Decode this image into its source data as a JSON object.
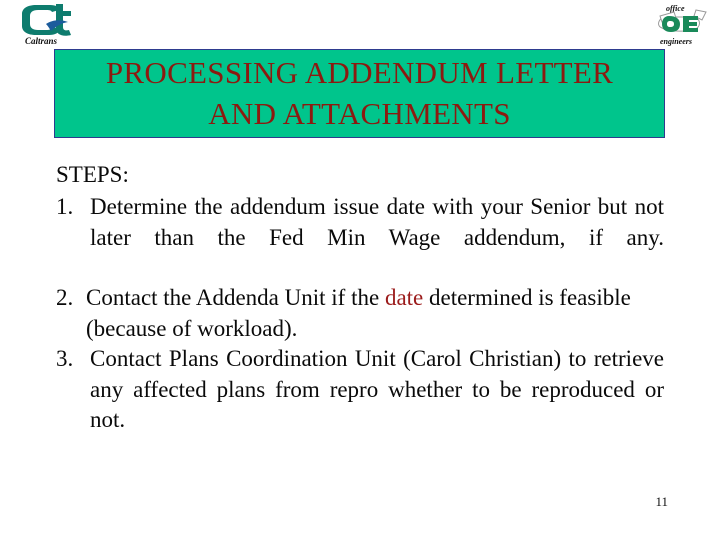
{
  "slide": {
    "title_line1": "PROCESSING ADDENDUM LETTER",
    "title_line2": "AND ATTACHMENTS",
    "title_full": "PROCESSING ADDENDUM LETTER\nAND ATTACHMENTS",
    "banner_color": "#00C58C",
    "banner_border_color": "#2E3B8F",
    "title_color": "#8C1A10",
    "page_number": "11"
  },
  "logos": {
    "left": {
      "name": "caltrans-logo",
      "wordmark": "Caltrans",
      "monogram": "Ct",
      "color": "#127A6E"
    },
    "right": {
      "name": "office-engineers-logo",
      "top_word": "office",
      "bottom_word": "engineers",
      "monogram": "OE",
      "color": "#1A8A5A"
    }
  },
  "body": {
    "steps_label": "STEPS:",
    "steps": [
      {
        "number": "1.",
        "text_before": "Determine the addendum issue date with your Senior but not later than the Fed Min Wage addendum, if any.",
        "highlight": "",
        "text_after": ""
      },
      {
        "number": "2.",
        "text_before": "Contact the Addenda Unit if the ",
        "highlight": "date",
        "text_after": " determined is feasible (because of workload)."
      },
      {
        "number": "3.",
        "text_before": "Contact Plans Coordination Unit (Carol Christian) to retrieve any affected plans from repro whether to be reproduced or not.",
        "highlight": "",
        "text_after": ""
      }
    ],
    "highlight_color": "#9B1B1B"
  }
}
